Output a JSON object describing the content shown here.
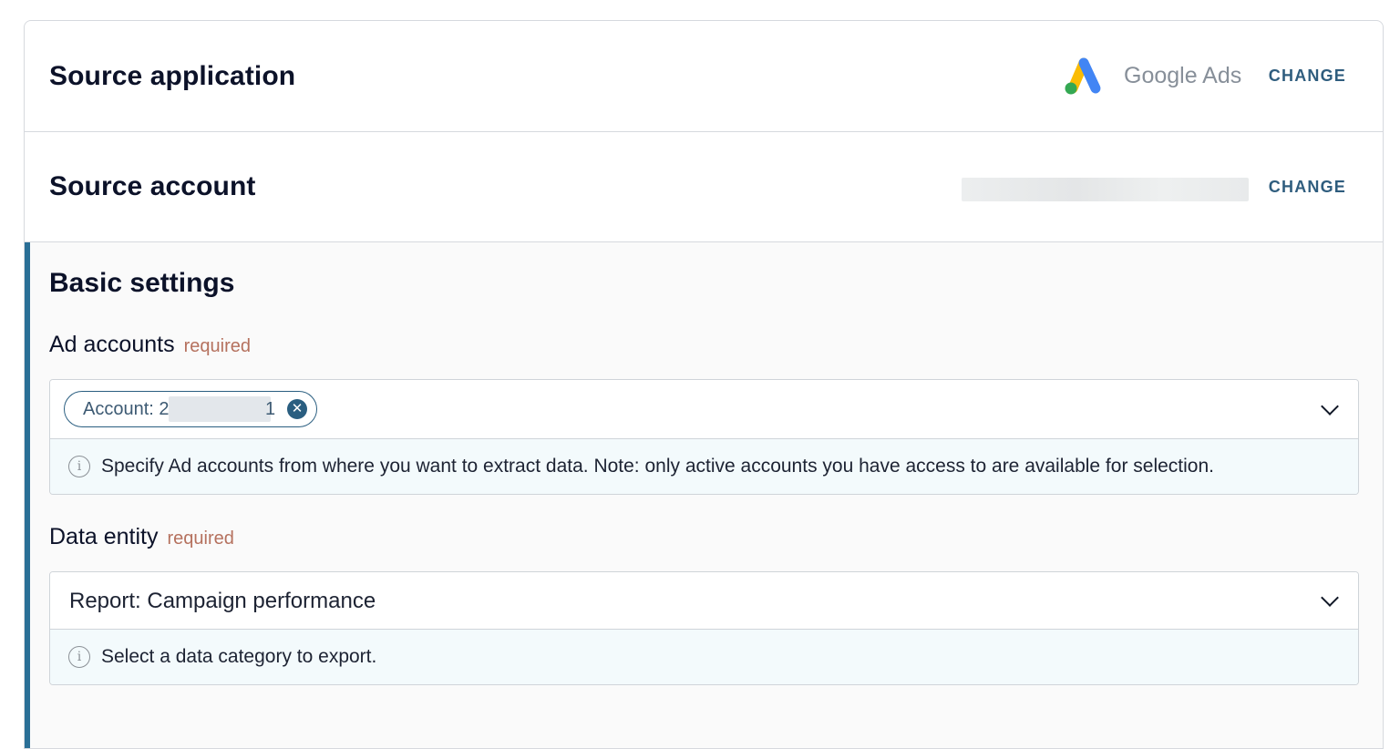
{
  "source_application": {
    "title": "Source application",
    "app_name": "Google Ads",
    "change_label": "CHANGE",
    "logo_colors": {
      "yellow": "#FBBC04",
      "blue": "#4285F4",
      "green": "#34A853"
    }
  },
  "source_account": {
    "title": "Source account",
    "change_label": "CHANGE"
  },
  "basic_settings": {
    "title": "Basic settings",
    "ad_accounts": {
      "label": "Ad accounts",
      "required_label": "required",
      "chip_label": "Account: 2",
      "chip_tail": "1",
      "hint": "Specify Ad accounts from where you want to extract data. Note: only active accounts you have access to are available for selection."
    },
    "data_entity": {
      "label": "Data entity",
      "required_label": "required",
      "value": "Report: Campaign performance",
      "hint": "Select a data category to export."
    }
  },
  "colors": {
    "accent": "#2a6f96",
    "change_text": "#2f5d7e",
    "required_text": "#b5715e"
  }
}
